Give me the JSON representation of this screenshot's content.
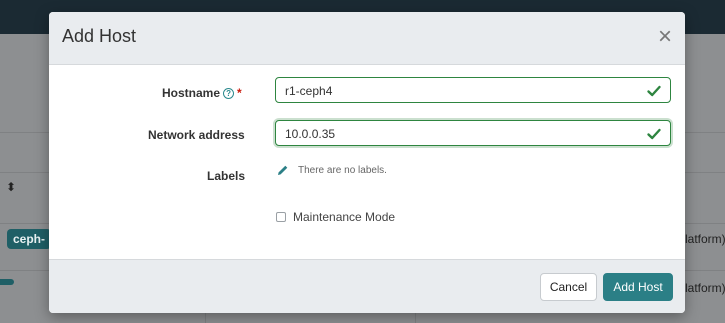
{
  "modal": {
    "title": "Add Host",
    "close_glyph": "×",
    "fields": {
      "hostname": {
        "label": "Hostname",
        "value": "r1-ceph4",
        "required_mark": "*",
        "help_glyph": "?"
      },
      "network_address": {
        "label": "Network address",
        "value": "10.0.0.35"
      },
      "labels": {
        "label": "Labels",
        "empty_text": "There are no labels."
      },
      "maintenance": {
        "label": "Maintenance Mode",
        "checked": false
      }
    },
    "buttons": {
      "cancel": "Cancel",
      "submit": "Add Host"
    }
  },
  "background": {
    "badge_1": "ceph-",
    "row_text_1": "latform)",
    "row_text_2": "latform)"
  },
  "colors": {
    "accent": "#2b7f86",
    "valid": "#2e8540",
    "overlay": "#8d8f91",
    "topbar": "#1b2a33"
  },
  "icons": [
    "help-icon",
    "check-icon",
    "pencil-icon",
    "close-icon",
    "sort-icon"
  ]
}
